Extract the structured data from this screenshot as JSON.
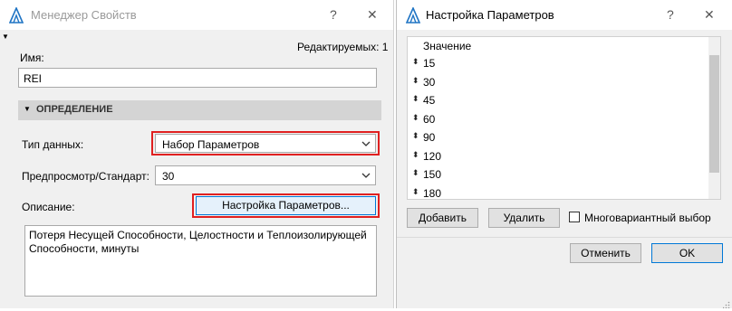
{
  "left_window": {
    "title": "Менеджер Свойств",
    "help_glyph": "?",
    "close_glyph": "✕",
    "editing_count": "Редактируемых: 1",
    "name_label": "Имя:",
    "name_value": "REI",
    "section_header": "ОПРЕДЕЛЕНИЕ",
    "data_type_label": "Тип данных:",
    "data_type_value": "Набор Параметров",
    "preview_label": "Предпросмотр/Стандарт:",
    "preview_value": "30",
    "description_label": "Описание:",
    "setup_button_label": "Настройка Параметров...",
    "description_text": "Потеря Несущей Способности, Целостности и Теплоизолирующей Способности, минуты"
  },
  "right_window": {
    "title": "Настройка Параметров",
    "help_glyph": "?",
    "close_glyph": "✕",
    "list_header": "Значение",
    "values": [
      "15",
      "30",
      "45",
      "60",
      "90",
      "120",
      "150",
      "180"
    ],
    "add_button": "Добавить",
    "delete_button": "Удалить",
    "multivariant_label": "Многовариантный выбор",
    "multivariant_checked": false,
    "cancel_button": "Отменить",
    "ok_button": "OK"
  },
  "colors": {
    "highlight_border": "#e02020",
    "focus_button_border": "#0078d7",
    "logo_blue": "#1f74c4"
  }
}
